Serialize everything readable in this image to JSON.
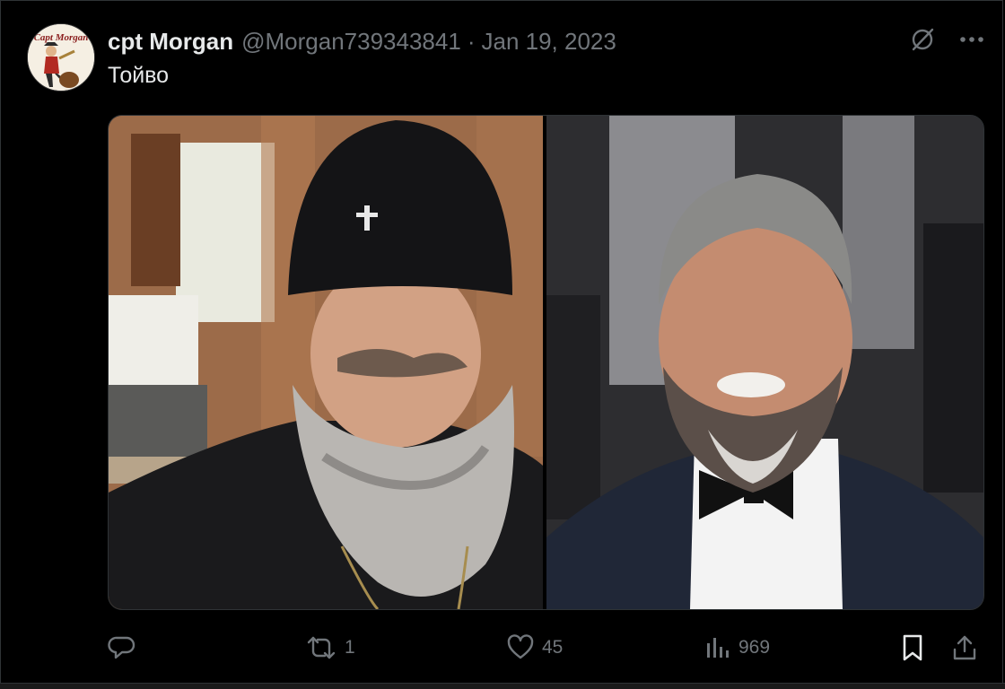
{
  "tweet": {
    "author_name": "cpt Morgan",
    "handle": "@Morgan739343841",
    "separator": "·",
    "date": "Jan 19, 2023",
    "text": "Тойво"
  },
  "avatar": {
    "logo_text": "Capt Morgan"
  },
  "media": {
    "images": [
      {
        "subject": "bearded cleric in black kamilavka with cross"
      },
      {
        "subject": "smiling grey-bearded man in tuxedo with bow tie"
      }
    ]
  },
  "stats": {
    "replies": "",
    "reposts": "1",
    "likes": "45",
    "views": "969"
  },
  "colors": {
    "background": "#000000",
    "primary_text": "#e7e9ea",
    "secondary_text": "#71767b",
    "border": "#2f3336"
  },
  "icons": [
    "grok-icon",
    "more-icon",
    "reply-icon",
    "repost-icon",
    "like-icon",
    "views-icon",
    "bookmark-icon",
    "share-icon"
  ]
}
